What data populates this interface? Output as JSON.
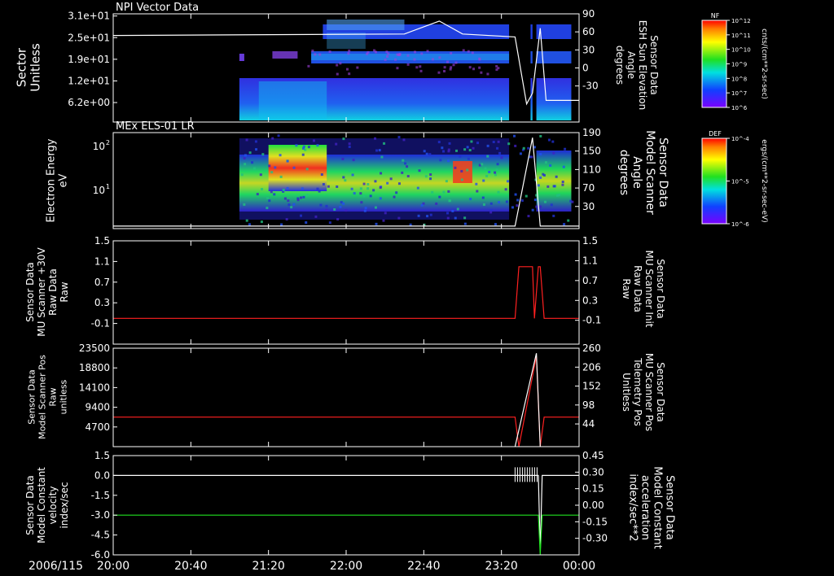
{
  "colors": {
    "background": "#000000",
    "axis": "#ffffff",
    "red_trace": "#ff2020",
    "green_trace": "#20e020",
    "white_trace": "#ffffff"
  },
  "time_axis": {
    "date_label": "2006/115",
    "ticks": [
      "20:00",
      "20:40",
      "21:20",
      "22:00",
      "22:40",
      "23:20",
      "00:00"
    ]
  },
  "chart_data": [
    {
      "type": "heatmap",
      "title": "NPI Vector Data",
      "ylabel": [
        "Sector",
        "Unitless"
      ],
      "ytick_labels": [
        "3.1e+01",
        "2.5e+01",
        "1.9e+01",
        "1.2e+01",
        "6.2e+00"
      ],
      "right_axis": {
        "label": [
          "Sensor Data",
          "ESH Sun Elevation",
          "Angle",
          "degrees"
        ],
        "ticks": [
          "90",
          "60",
          "30",
          "0",
          "-30"
        ],
        "range": [
          -60,
          90
        ]
      },
      "colorbar": {
        "title": "NF",
        "unit": "cnts/(cm**2-sr-sec)",
        "tick_labels": [
          "10^12",
          "10^11",
          "10^10",
          "10^9",
          "10^8",
          "10^7",
          "10^6"
        ]
      },
      "overlay_series": {
        "name": "ESH Sun Elevation Angle",
        "x": [
          "20:00",
          "22:30",
          "22:48",
          "23:00",
          "23:27",
          "23:33",
          "23:36",
          "23:40",
          "23:43",
          "00:00"
        ],
        "y": [
          60,
          62,
          80,
          62,
          58,
          -35,
          -20,
          70,
          -30,
          -30
        ]
      }
    },
    {
      "type": "heatmap",
      "title": "MEx ELS-01 LR",
      "ylabel": [
        "Electron Energy",
        "eV"
      ],
      "ytick_labels": [
        "10^2",
        "10^1"
      ],
      "right_axis": {
        "label": [
          "Sensor Data",
          "Model Scanner",
          "Angle",
          "degrees"
        ],
        "ticks": [
          "190",
          "150",
          "110",
          "70",
          "30"
        ],
        "range": [
          0,
          190
        ]
      },
      "colorbar": {
        "title": "DEF",
        "unit": "ergs/(cm**2-sr-sec-eV)",
        "tick_labels": [
          "10^-4",
          "10^-5",
          "10^-6"
        ]
      },
      "overlay_series": {
        "name": "Model Scanner Angle",
        "x": [
          "20:00",
          "23:27",
          "23:36",
          "23:40",
          "00:00"
        ],
        "y": [
          5,
          5,
          180,
          5,
          5
        ]
      }
    },
    {
      "type": "line",
      "ylabel": [
        "Sensor Data",
        "MU Scanner +30V",
        "Raw Data",
        "Raw"
      ],
      "yticks": [
        "1.5",
        "1.1",
        "0.7",
        "0.3",
        "-0.1"
      ],
      "ylim": [
        -0.5,
        1.5
      ],
      "right_axis": {
        "label": [
          "Sensor Data",
          "MU Scanner Init",
          "Raw Data",
          "Raw"
        ],
        "ticks": [
          "1.5",
          "1.1",
          "0.7",
          "0.3",
          "-0.1"
        ],
        "color": "#ff2020"
      },
      "series": [
        {
          "color": "#ff2020",
          "x": [
            "20:00",
            "23:27",
            "23:29",
            "23:36",
            "23:37",
            "23:39",
            "23:40",
            "23:42",
            "00:00"
          ],
          "y": [
            0,
            0,
            1,
            1,
            0,
            1,
            1,
            0,
            0
          ]
        }
      ]
    },
    {
      "type": "line",
      "ylabel": [
        "Sensor Data",
        "Model Scanner Pos",
        "Raw",
        "unitless"
      ],
      "yticks": [
        "23500",
        "18800",
        "14100",
        "9400",
        "4700"
      ],
      "ylim": [
        0,
        23500
      ],
      "right_axis": {
        "label": [
          "Sensor Data",
          "MU Scanner Pos",
          "Telemetry Pos",
          "Unitless"
        ],
        "ticks": [
          "260",
          "206",
          "152",
          "98",
          "44"
        ],
        "color": "#ff2020"
      },
      "series": [
        {
          "color": "#ff2020",
          "x": [
            "20:00",
            "23:27",
            "23:29",
            "23:38",
            "23:40",
            "23:42",
            "00:00"
          ],
          "y": [
            7050,
            7050,
            0,
            21600,
            0,
            7050,
            7050
          ]
        },
        {
          "color": "#ffffff",
          "x": [
            "23:27",
            "23:38",
            "23:40"
          ],
          "y": [
            0,
            22300,
            0
          ]
        }
      ]
    },
    {
      "type": "line",
      "ylabel": [
        "Sensor Data",
        "Model Constant",
        "velocity",
        "index/sec"
      ],
      "yticks": [
        "1.5",
        "0.0",
        "-1.5",
        "-3.0",
        "-4.5",
        "-6.0"
      ],
      "ylim": [
        -6.0,
        1.5
      ],
      "right_axis": {
        "label": [
          "Sensor Data",
          "Model Constant",
          "acceleration",
          "index/sec**2"
        ],
        "ticks": [
          "0.45",
          "0.30",
          "0.15",
          "0.00",
          "-0.15",
          "-0.30"
        ],
        "color": "#20e020"
      },
      "series": [
        {
          "color": "#ffffff",
          "x": [
            "20:00",
            "23:27",
            "23:39",
            "23:40",
            "23:41",
            "00:00"
          ],
          "y": [
            0,
            0,
            0,
            -5.8,
            0,
            0
          ]
        },
        {
          "color": "#20e020",
          "x": [
            "20:00",
            "23:39",
            "23:40",
            "23:41",
            "00:00"
          ],
          "y": [
            -3.0,
            -3.0,
            -6.0,
            -3.0,
            -3.0
          ]
        }
      ]
    }
  ]
}
